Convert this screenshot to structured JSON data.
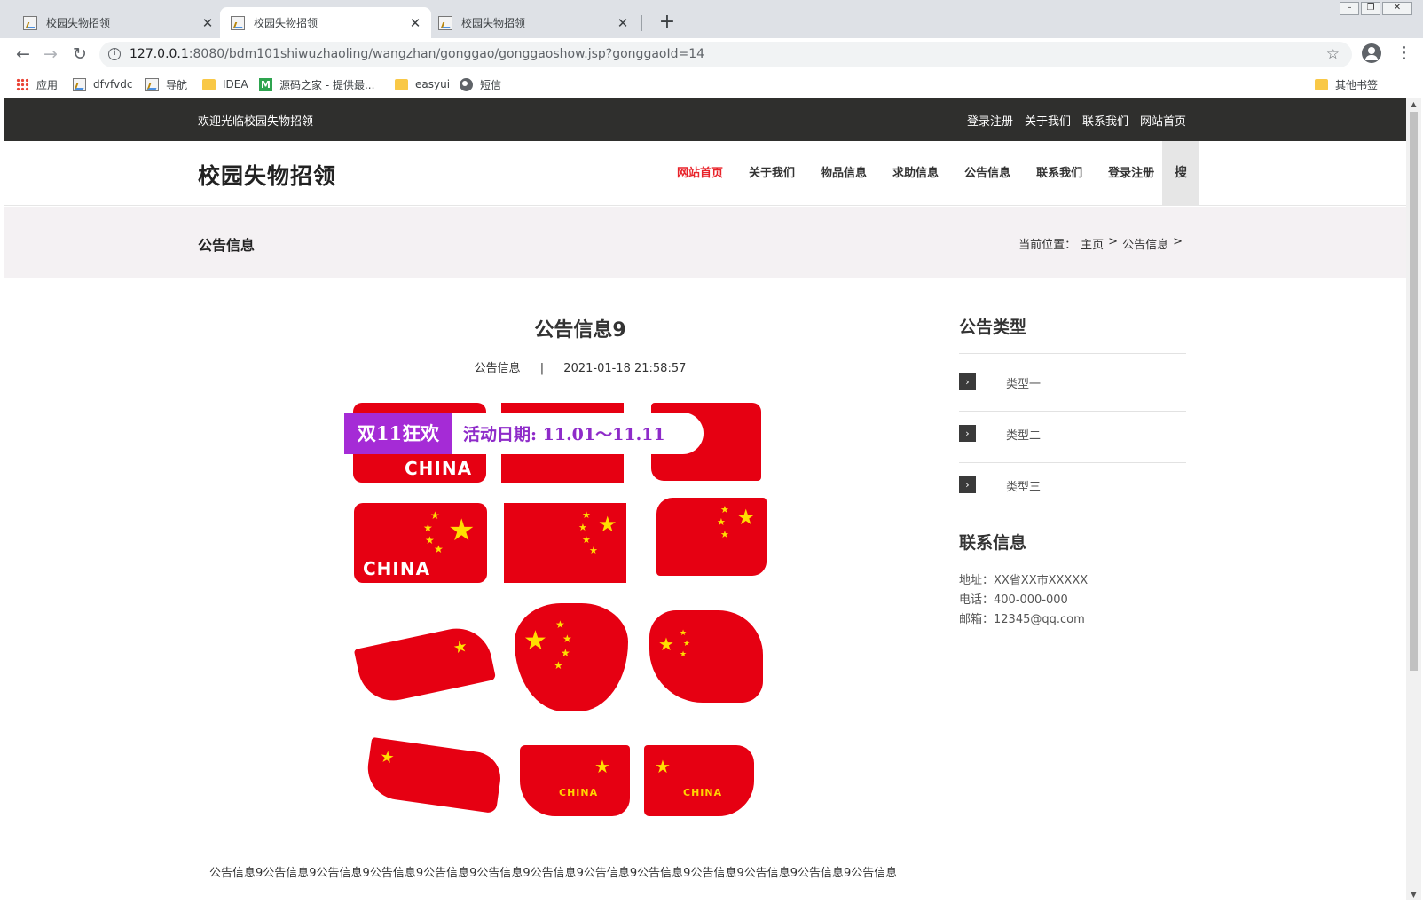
{
  "browser": {
    "tabs": [
      {
        "title": "校园失物招领",
        "active": false
      },
      {
        "title": "校园失物招领",
        "active": true
      },
      {
        "title": "校园失物招领",
        "active": false
      }
    ],
    "url_host": "127.0.0.1",
    "url_rest": ":8080/bdm101shiwuzhaoling/wangzhan/gonggao/gonggaoshow.jsp?gonggaoId=14",
    "bookmarks": [
      {
        "label": "应用",
        "icon": "apps-icon"
      },
      {
        "label": "dfvfvdc",
        "icon": "page-icon"
      },
      {
        "label": "导航",
        "icon": "page-icon"
      },
      {
        "label": "IDEA",
        "icon": "folder-icon"
      },
      {
        "label": "源码之家 - 提供最...",
        "icon": "m-icon"
      },
      {
        "label": "easyui",
        "icon": "folder-icon"
      },
      {
        "label": "短信",
        "icon": "globe-icon"
      }
    ],
    "other_bookmarks": "其他书签"
  },
  "topbar": {
    "welcome": "欢迎光临校园失物招领",
    "links": [
      "登录注册",
      "关于我们",
      "联系我们",
      "网站首页"
    ]
  },
  "header": {
    "site_title": "校园失物招领",
    "nav": [
      "网站首页",
      "关于我们",
      "物品信息",
      "求助信息",
      "公告信息",
      "联系我们",
      "登录注册"
    ],
    "active_nav": "网站首页",
    "search_label": "搜"
  },
  "page_head": {
    "title": "公告信息",
    "crumb_prefix": "当前位置：",
    "crumb_home": "主页",
    "crumb_sep": ">",
    "crumb_current": "公告信息"
  },
  "article": {
    "title": "公告信息9",
    "category": "公告信息",
    "separator": "|",
    "datetime": "2021-01-18 21:58:57",
    "image": {
      "promo_tag": "双11狂欢",
      "promo_date": "活动日期: 11.01～11.11",
      "sticker_text": "CHINA"
    },
    "body": "公告信息9公告信息9公告信息9公告信息9公告信息9公告信息9公告信息9公告信息9公告信息9公告信息9公告信息9公告信息9公告信息"
  },
  "sidebar": {
    "types_heading": "公告类型",
    "types": [
      "类型一",
      "类型二",
      "类型三"
    ],
    "contact_heading": "联系信息",
    "contact": [
      "地址：XX省XX市XXXXX",
      "电话：400-000-000",
      "邮箱：12345@qq.com"
    ]
  },
  "colors": {
    "topbar_bg": "#2f2f2d",
    "accent_red": "#e8232a",
    "pagehead_bg": "#f4f1f3",
    "flag_red": "#e60012",
    "star_yellow": "#ffde00",
    "promo_purple": "#a52bd6"
  }
}
